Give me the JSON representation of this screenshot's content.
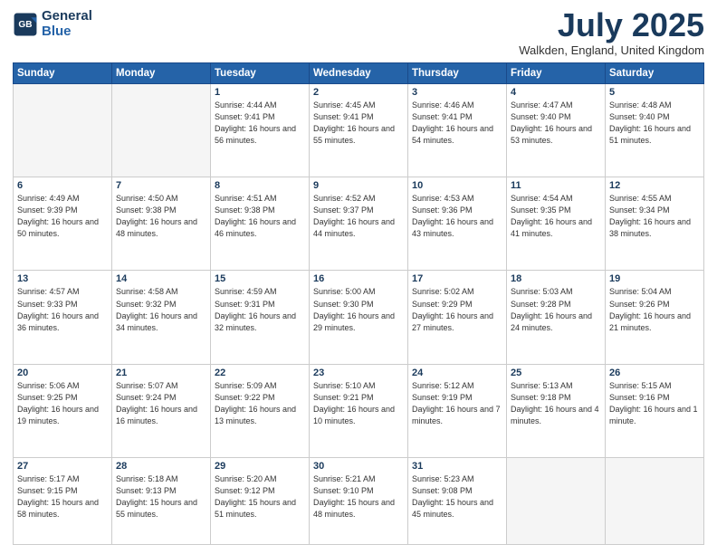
{
  "header": {
    "logo_line1": "General",
    "logo_line2": "Blue",
    "month": "July 2025",
    "location": "Walkden, England, United Kingdom"
  },
  "days_of_week": [
    "Sunday",
    "Monday",
    "Tuesday",
    "Wednesday",
    "Thursday",
    "Friday",
    "Saturday"
  ],
  "weeks": [
    [
      {
        "day": "",
        "info": ""
      },
      {
        "day": "",
        "info": ""
      },
      {
        "day": "1",
        "info": "Sunrise: 4:44 AM\nSunset: 9:41 PM\nDaylight: 16 hours and 56 minutes."
      },
      {
        "day": "2",
        "info": "Sunrise: 4:45 AM\nSunset: 9:41 PM\nDaylight: 16 hours and 55 minutes."
      },
      {
        "day": "3",
        "info": "Sunrise: 4:46 AM\nSunset: 9:41 PM\nDaylight: 16 hours and 54 minutes."
      },
      {
        "day": "4",
        "info": "Sunrise: 4:47 AM\nSunset: 9:40 PM\nDaylight: 16 hours and 53 minutes."
      },
      {
        "day": "5",
        "info": "Sunrise: 4:48 AM\nSunset: 9:40 PM\nDaylight: 16 hours and 51 minutes."
      }
    ],
    [
      {
        "day": "6",
        "info": "Sunrise: 4:49 AM\nSunset: 9:39 PM\nDaylight: 16 hours and 50 minutes."
      },
      {
        "day": "7",
        "info": "Sunrise: 4:50 AM\nSunset: 9:38 PM\nDaylight: 16 hours and 48 minutes."
      },
      {
        "day": "8",
        "info": "Sunrise: 4:51 AM\nSunset: 9:38 PM\nDaylight: 16 hours and 46 minutes."
      },
      {
        "day": "9",
        "info": "Sunrise: 4:52 AM\nSunset: 9:37 PM\nDaylight: 16 hours and 44 minutes."
      },
      {
        "day": "10",
        "info": "Sunrise: 4:53 AM\nSunset: 9:36 PM\nDaylight: 16 hours and 43 minutes."
      },
      {
        "day": "11",
        "info": "Sunrise: 4:54 AM\nSunset: 9:35 PM\nDaylight: 16 hours and 41 minutes."
      },
      {
        "day": "12",
        "info": "Sunrise: 4:55 AM\nSunset: 9:34 PM\nDaylight: 16 hours and 38 minutes."
      }
    ],
    [
      {
        "day": "13",
        "info": "Sunrise: 4:57 AM\nSunset: 9:33 PM\nDaylight: 16 hours and 36 minutes."
      },
      {
        "day": "14",
        "info": "Sunrise: 4:58 AM\nSunset: 9:32 PM\nDaylight: 16 hours and 34 minutes."
      },
      {
        "day": "15",
        "info": "Sunrise: 4:59 AM\nSunset: 9:31 PM\nDaylight: 16 hours and 32 minutes."
      },
      {
        "day": "16",
        "info": "Sunrise: 5:00 AM\nSunset: 9:30 PM\nDaylight: 16 hours and 29 minutes."
      },
      {
        "day": "17",
        "info": "Sunrise: 5:02 AM\nSunset: 9:29 PM\nDaylight: 16 hours and 27 minutes."
      },
      {
        "day": "18",
        "info": "Sunrise: 5:03 AM\nSunset: 9:28 PM\nDaylight: 16 hours and 24 minutes."
      },
      {
        "day": "19",
        "info": "Sunrise: 5:04 AM\nSunset: 9:26 PM\nDaylight: 16 hours and 21 minutes."
      }
    ],
    [
      {
        "day": "20",
        "info": "Sunrise: 5:06 AM\nSunset: 9:25 PM\nDaylight: 16 hours and 19 minutes."
      },
      {
        "day": "21",
        "info": "Sunrise: 5:07 AM\nSunset: 9:24 PM\nDaylight: 16 hours and 16 minutes."
      },
      {
        "day": "22",
        "info": "Sunrise: 5:09 AM\nSunset: 9:22 PM\nDaylight: 16 hours and 13 minutes."
      },
      {
        "day": "23",
        "info": "Sunrise: 5:10 AM\nSunset: 9:21 PM\nDaylight: 16 hours and 10 minutes."
      },
      {
        "day": "24",
        "info": "Sunrise: 5:12 AM\nSunset: 9:19 PM\nDaylight: 16 hours and 7 minutes."
      },
      {
        "day": "25",
        "info": "Sunrise: 5:13 AM\nSunset: 9:18 PM\nDaylight: 16 hours and 4 minutes."
      },
      {
        "day": "26",
        "info": "Sunrise: 5:15 AM\nSunset: 9:16 PM\nDaylight: 16 hours and 1 minute."
      }
    ],
    [
      {
        "day": "27",
        "info": "Sunrise: 5:17 AM\nSunset: 9:15 PM\nDaylight: 15 hours and 58 minutes."
      },
      {
        "day": "28",
        "info": "Sunrise: 5:18 AM\nSunset: 9:13 PM\nDaylight: 15 hours and 55 minutes."
      },
      {
        "day": "29",
        "info": "Sunrise: 5:20 AM\nSunset: 9:12 PM\nDaylight: 15 hours and 51 minutes."
      },
      {
        "day": "30",
        "info": "Sunrise: 5:21 AM\nSunset: 9:10 PM\nDaylight: 15 hours and 48 minutes."
      },
      {
        "day": "31",
        "info": "Sunrise: 5:23 AM\nSunset: 9:08 PM\nDaylight: 15 hours and 45 minutes."
      },
      {
        "day": "",
        "info": ""
      },
      {
        "day": "",
        "info": ""
      }
    ]
  ]
}
